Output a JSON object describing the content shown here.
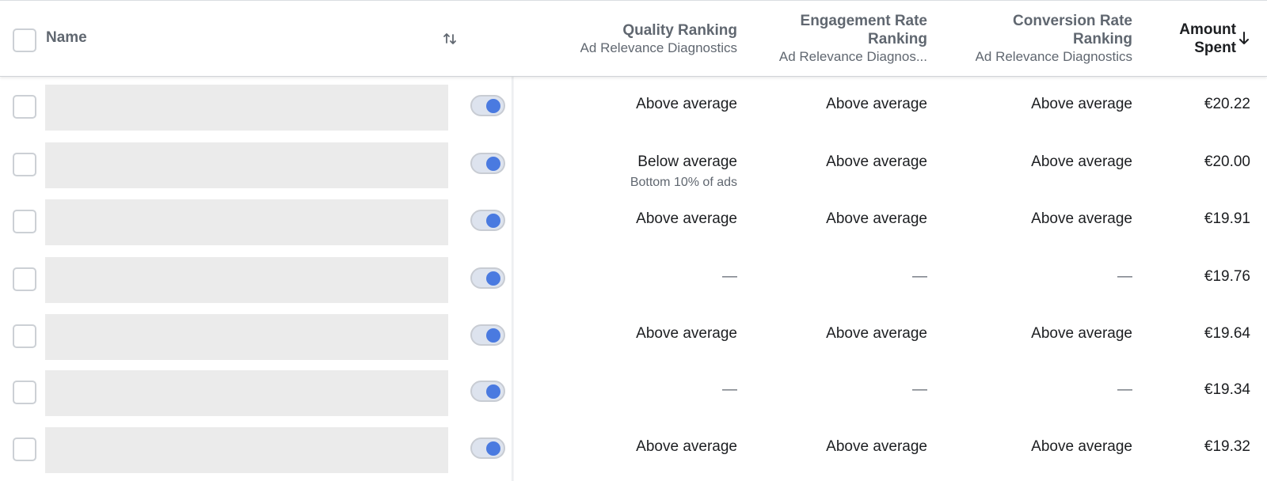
{
  "header": {
    "name_label": "Name",
    "columns": [
      {
        "title": "Quality Ranking",
        "subtitle": "Ad Relevance Diagnostics"
      },
      {
        "title": "Engagement Rate Ranking",
        "title_line1": "Engagement Rate",
        "title_line2": "Ranking",
        "subtitle": "Ad Relevance Diagnos..."
      },
      {
        "title": "Conversion Rate Ranking",
        "title_line1": "Conversion Rate",
        "title_line2": "Ranking",
        "subtitle": "Ad Relevance Diagnostics"
      },
      {
        "title": "Amount Spent",
        "title_line1": "Amount",
        "title_line2": "Spent",
        "sort_direction": "descending"
      }
    ]
  },
  "rows": [
    {
      "toggle_on": true,
      "quality": "Above average",
      "quality_note": "",
      "engagement": "Above average",
      "conversion": "Above average",
      "amount": "€20.22"
    },
    {
      "toggle_on": true,
      "quality": "Below average",
      "quality_note": "Bottom 10% of ads",
      "engagement": "Above average",
      "conversion": "Above average",
      "amount": "€20.00"
    },
    {
      "toggle_on": true,
      "quality": "Above average",
      "quality_note": "",
      "engagement": "Above average",
      "conversion": "Above average",
      "amount": "€19.91"
    },
    {
      "toggle_on": true,
      "quality": "—",
      "quality_note": "",
      "engagement": "—",
      "conversion": "—",
      "amount": "€19.76"
    },
    {
      "toggle_on": true,
      "quality": "Above average",
      "quality_note": "",
      "engagement": "Above average",
      "conversion": "Above average",
      "amount": "€19.64"
    },
    {
      "toggle_on": true,
      "quality": "—",
      "quality_note": "",
      "engagement": "—",
      "conversion": "—",
      "amount": "€19.34"
    },
    {
      "toggle_on": true,
      "quality": "Above average",
      "quality_note": "",
      "engagement": "Above average",
      "conversion": "Above average",
      "amount": "€19.32"
    }
  ],
  "colors": {
    "toggle_knob": "#4a7ae0",
    "toggle_track": "#dde3ee",
    "name_placeholder": "#ebebeb",
    "header_text": "#606770"
  }
}
